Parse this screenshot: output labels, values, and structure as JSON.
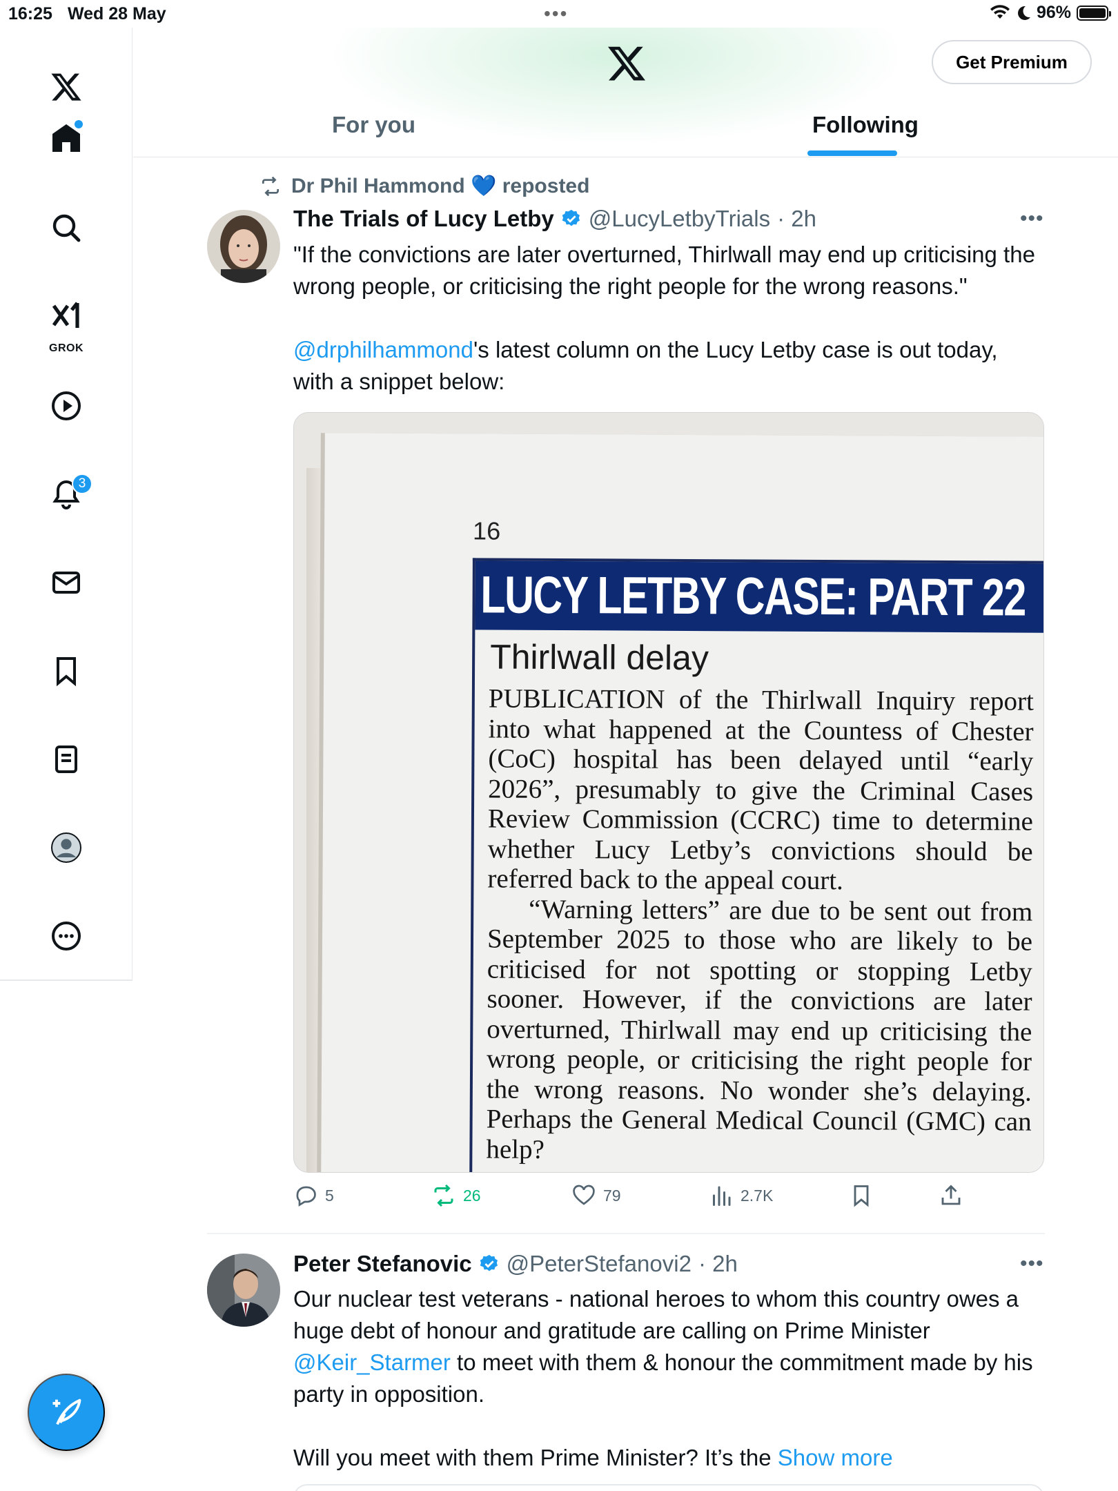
{
  "status": {
    "time": "16:25",
    "date": "Wed 28 May",
    "battery": "96%"
  },
  "sidebar": {
    "items": [
      {
        "name": "x-logo"
      },
      {
        "name": "home"
      },
      {
        "name": "search"
      },
      {
        "name": "grok",
        "label": "GROK"
      },
      {
        "name": "video"
      },
      {
        "name": "notifications",
        "badge": "3"
      },
      {
        "name": "messages"
      },
      {
        "name": "bookmarks"
      },
      {
        "name": "lists"
      },
      {
        "name": "profile"
      },
      {
        "name": "more"
      }
    ]
  },
  "header": {
    "premium_label": "Get Premium",
    "tabs": [
      "For you",
      "Following"
    ],
    "active_tab": "Following"
  },
  "tweet1": {
    "repost_by": "Dr Phil Hammond",
    "repost_heart": "💙",
    "repost_suffix": "reposted",
    "name": "The Trials of Lucy Letby",
    "handle": "@LucyLetbyTrials",
    "time": "· 2h",
    "text_line1": "\"If the convictions are later overturned, Thirlwall may end up criticising the wrong people, or criticising the right people for the wrong reasons.\"",
    "mention": "@drphilhammond",
    "text_line2": "'s latest column on the Lucy Letby case is out today, with a snippet below:",
    "media": {
      "page_number": "16",
      "headline": "LUCY LETBY CASE: PART 22",
      "subhead": "Thirlwall delay",
      "para1": "PUBLICATION of the Thirlwall Inquiry report into what happened at the Countess of Chester (CoC) hospital has been delayed until “early 2026”, presumably to give the Criminal Cases Review Commission (CCRC) time to determine whether Lucy Letby’s convictions should be referred back to the appeal court.",
      "para2": "“Warning letters” are due to be sent out from September 2025 to those who are likely to be criticised for not spotting or stopping Letby sooner. However, if the convictions are later overturned, Thirlwall may end up criticising the wrong people, or criticising the right people for the wrong reasons. No wonder she’s delaying. Perhaps the General Medical Council (GMC) can help?"
    },
    "stats": {
      "replies": "5",
      "reposts": "26",
      "likes": "79",
      "views": "2.7K"
    }
  },
  "tweet2": {
    "name": "Peter Stefanovic",
    "handle": "@PeterStefanovi2",
    "time": "· 2h",
    "text_a": "Our nuclear test veterans - national heroes to whom this country owes a huge debt of honour and gratitude are calling on Prime Minister ",
    "mention": "@Keir_Starmer",
    "text_b": " to meet with them & honour the commitment made by his party in opposition.",
    "text_c": "Will you meet with them Prime Minister? It’s the ",
    "show_more": "Show more"
  },
  "colors": {
    "accent": "#1d9bf0",
    "repost_green": "#00ba7c",
    "muted": "#536471"
  }
}
